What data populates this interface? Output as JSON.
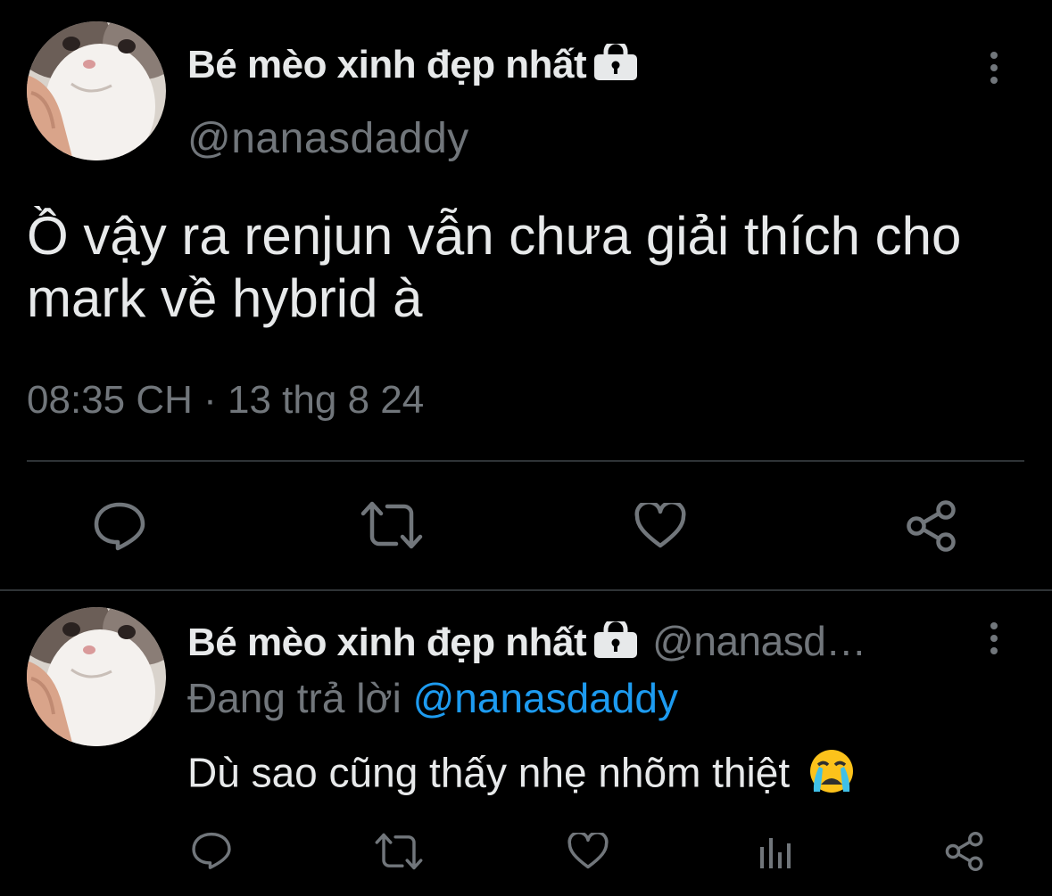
{
  "tweet": {
    "author_name": "Bé mèo xinh đẹp nhất",
    "handle": "@nanasdaddy",
    "text": "Ồ vậy ra renjun vẫn chưa giải thích cho mark về hybrid à",
    "time": "08:35 CH",
    "separator": "·",
    "date": "13 thg 8 24",
    "actions": [
      "reply-icon",
      "retweet-icon",
      "like-icon",
      "share-icon"
    ]
  },
  "reply": {
    "author_name": "Bé mèo xinh đẹp nhất",
    "handle_truncated": "@nanasd…",
    "replying_prefix": "Đang trả lời",
    "replying_to": "@nanasdaddy",
    "text": "Dù sao cũng thấy nhẹ nhõm thiệt",
    "emoji": "😭",
    "actions": [
      "reply-icon",
      "retweet-icon",
      "like-icon",
      "views-icon",
      "share-icon"
    ]
  },
  "colors": {
    "background": "#000000",
    "text": "#e7e9ea",
    "secondary": "#71767b",
    "link": "#1d9bf0",
    "divider": "#2f3336"
  }
}
